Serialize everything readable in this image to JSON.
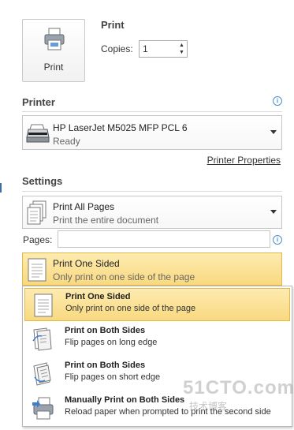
{
  "print_button": {
    "label": "Print"
  },
  "print_section": {
    "title": "Print",
    "copies_label": "Copies:",
    "copies_value": "1"
  },
  "printer": {
    "section_title": "Printer",
    "name": "HP LaserJet M5025 MFP PCL 6",
    "status": "Ready",
    "properties_link": "Printer Properties"
  },
  "settings": {
    "section_title": "Settings",
    "pages_dropdown": {
      "title": "Print All Pages",
      "subtitle": "Print the entire document"
    },
    "pages_label": "Pages:",
    "pages_value": "",
    "sides_dropdown": {
      "title": "Print One Sided",
      "subtitle": "Only print on one side of the page"
    }
  },
  "sides_menu": {
    "items": [
      {
        "title": "Print One Sided",
        "desc": "Only print on one side of the page",
        "selected": true
      },
      {
        "title": "Print on Both Sides",
        "desc": "Flip pages on long edge",
        "selected": false
      },
      {
        "title": "Print on Both Sides",
        "desc": "Flip pages on short edge",
        "selected": false
      },
      {
        "title": "Manually Print on Both Sides",
        "desc": "Reload paper when prompted to print the second side",
        "selected": false
      }
    ]
  },
  "watermark": {
    "main": "51CTO.com",
    "sub": "技术博客"
  },
  "colors": {
    "highlight": "#f9d980",
    "highlight_border": "#e3b84a",
    "info": "#4a8fd6"
  }
}
